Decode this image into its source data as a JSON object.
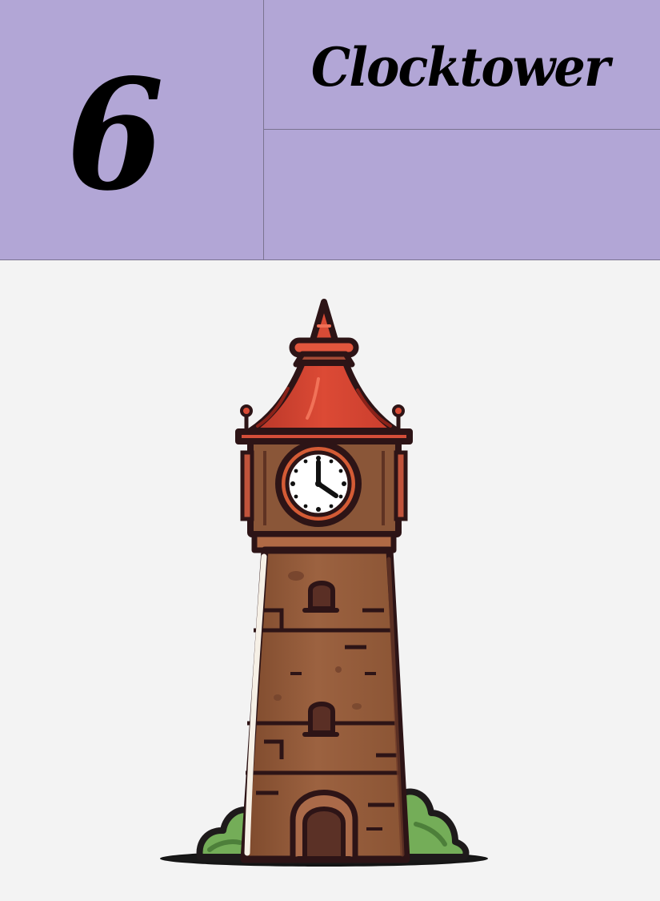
{
  "card": {
    "number": "6",
    "title": "Clocktower"
  },
  "theme": {
    "header_bg": "#b2a6d6",
    "roof_red": "#d84b36",
    "tower_brown": "#9a5e3d",
    "dark_outline": "#2d1416",
    "bush_green": "#6eab54"
  },
  "illustration": {
    "icon": "clocktower-icon"
  }
}
